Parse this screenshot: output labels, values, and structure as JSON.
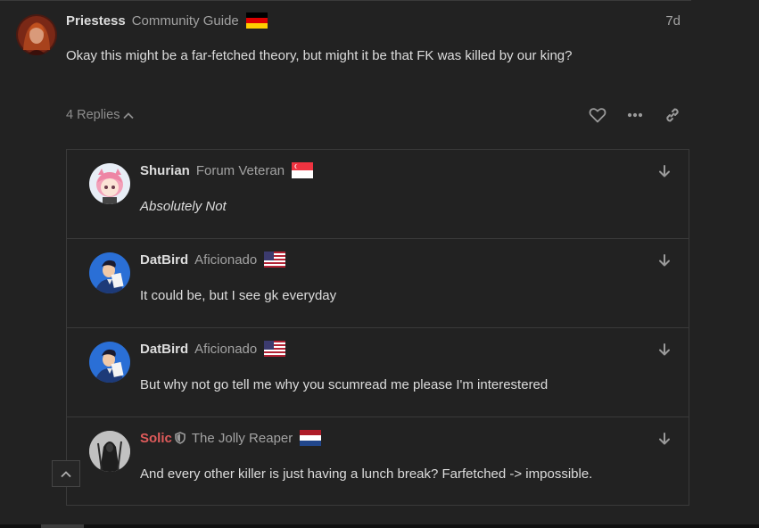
{
  "post": {
    "username": "Priestess",
    "user_title": "Community Guide",
    "flag": "germany-flag",
    "time": "7d",
    "body": "Okay this might be a far-fetched theory, but might it be that FK was killed by our king?",
    "replies_label": "4 Replies",
    "actions": [
      "like-icon",
      "more-icon",
      "link-icon"
    ]
  },
  "replies": [
    {
      "username": "Shurian",
      "user_title": "Forum Veteran",
      "flag": "singapore-flag",
      "body": "Absolutely Not"
    },
    {
      "username": "DatBird",
      "user_title": "Aficionado",
      "flag": "usa-flag",
      "body": "It could be, but I see gk everyday"
    },
    {
      "username": "DatBird",
      "user_title": "Aficionado",
      "flag": "usa-flag",
      "body": "But why not go tell me why you scumread me please I'm interestered"
    },
    {
      "username": "Solic",
      "user_title": "The Jolly Reaper",
      "flag": "netherlands-flag",
      "badge": "shield-icon",
      "body": "And every other killer is just having a lunch break? Farfetched -> impossible."
    }
  ],
  "colors": {
    "background": "#222222",
    "text": "#dddddd",
    "muted": "#a2a2a2",
    "border": "#3a3a3a",
    "moderator_name": "#e05b5b"
  }
}
